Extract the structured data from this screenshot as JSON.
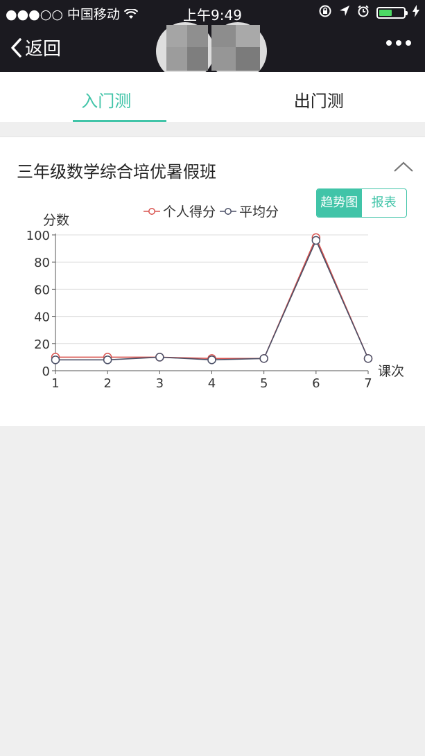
{
  "status": {
    "carrier": "●●●○○ 中国移动",
    "time": "上午9:49"
  },
  "nav": {
    "back_label": "返回"
  },
  "tabs": [
    {
      "label": "入门测",
      "active": true
    },
    {
      "label": "出门测",
      "active": false
    }
  ],
  "card": {
    "title": "三年级数学综合培优暑假班",
    "toggle": [
      "趋势图",
      "报表"
    ]
  },
  "colors": {
    "accent": "#41c4a8",
    "series_personal": "#d9534f",
    "series_average": "#4a4f66"
  },
  "chart_data": {
    "type": "line",
    "ylabel": "分数",
    "xlabel": "课次",
    "x": [
      1,
      2,
      3,
      4,
      5,
      6,
      7
    ],
    "ylim": [
      0,
      100
    ],
    "yticks": [
      0,
      20,
      40,
      60,
      80,
      100
    ],
    "grid": true,
    "legend_position": "top",
    "series": [
      {
        "name": "个人得分",
        "values": [
          10,
          10,
          10,
          9,
          9,
          98,
          9
        ]
      },
      {
        "name": "平均分",
        "values": [
          8,
          8,
          10,
          8,
          9,
          96,
          9
        ]
      }
    ]
  }
}
